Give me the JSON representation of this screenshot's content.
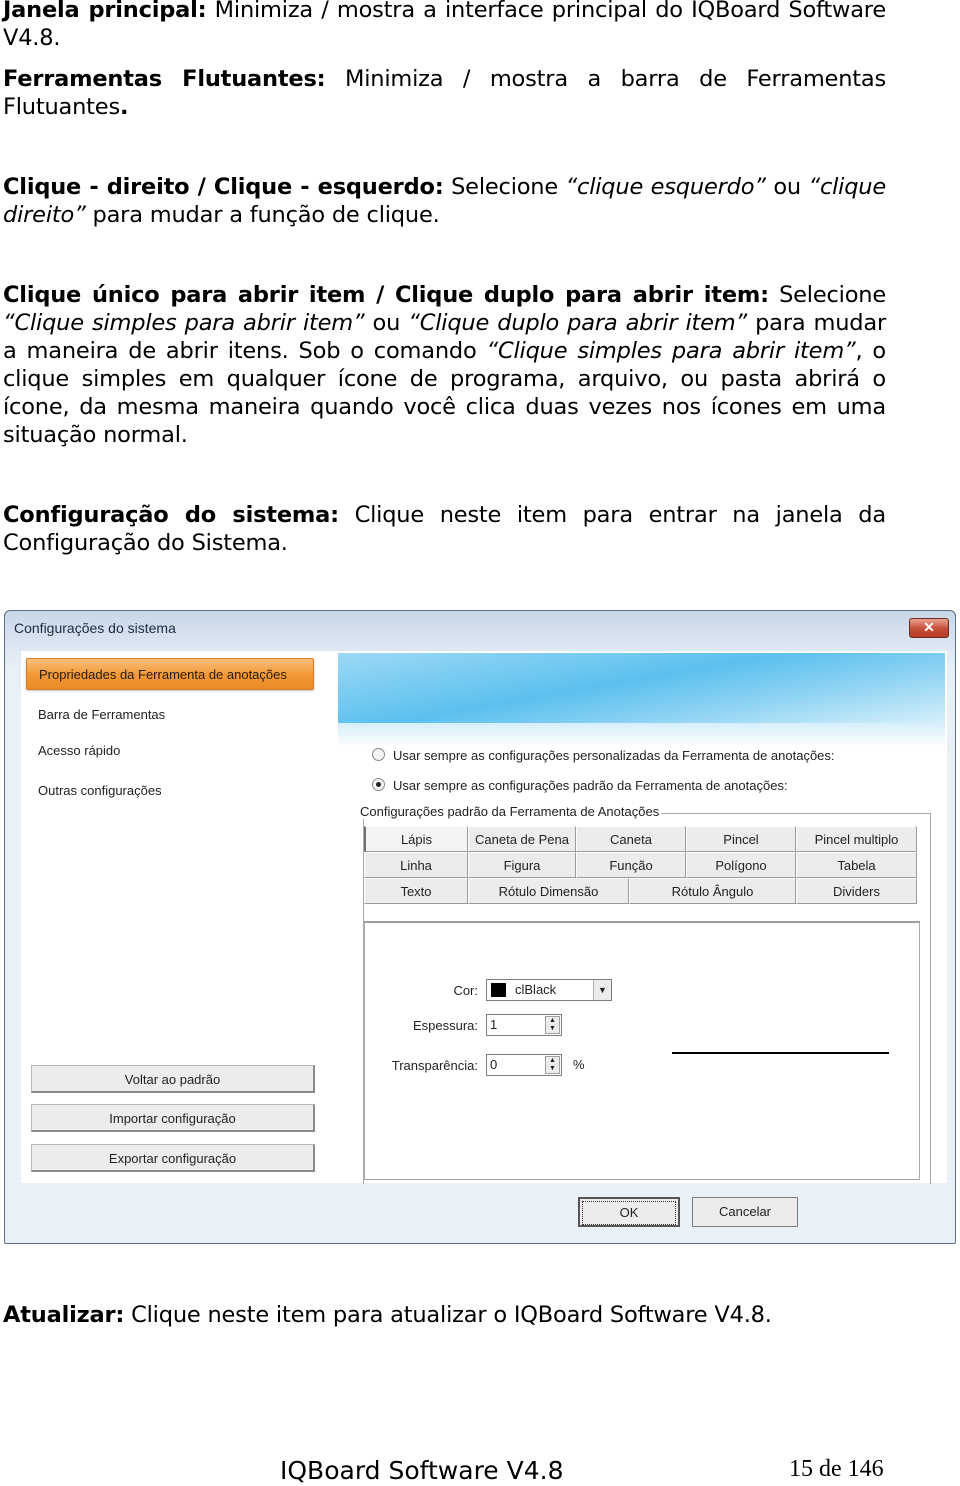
{
  "paragraphs": [
    {
      "term": "Janela principal:",
      "segments": [
        {
          "t": " Minimiza / mostra a interface principal do IQBoard Software V4.8.",
          "i": false
        }
      ]
    },
    {
      "term": "Ferramentas Flutuantes:",
      "segments": [
        {
          "t": " Minimiza / mostra a barra de Ferramentas Flutuantes",
          "i": false
        },
        {
          "t": ".",
          "b": true
        }
      ]
    },
    {
      "term": "Clique - direito / Clique - esquerdo:",
      "segments": [
        {
          "t": " Selecione ",
          "i": false
        },
        {
          "t": "“clique esquerdo”",
          "i": true
        },
        {
          "t": " ou ",
          "i": false
        },
        {
          "t": "“clique direito”",
          "i": true
        },
        {
          "t": " para mudar a função de clique.",
          "i": false
        }
      ]
    },
    {
      "term": "Clique único para abrir item / Clique duplo para abrir item:",
      "segments": [
        {
          "t": " Selecione ",
          "i": false
        },
        {
          "t": "“Clique simples para abrir item”",
          "i": true
        },
        {
          "t": " ou ",
          "i": false
        },
        {
          "t": "“Clique duplo para abrir item”",
          "i": true
        },
        {
          "t": " para mudar a maneira de abrir itens. Sob o comando ",
          "i": false
        },
        {
          "t": "“Clique simples para abrir item”",
          "i": true
        },
        {
          "t": ", o clique simples em qualquer ícone de programa, arquivo, ou pasta abrirá o ícone, da mesma maneira quando você clica duas vezes nos ícones em uma situação normal.",
          "i": false
        }
      ]
    },
    {
      "term": "Configuração do sistema:",
      "segments": [
        {
          "t": " Clique neste item para entrar na janela da Configuração do Sistema.",
          "i": false
        }
      ]
    },
    {
      "term": "Atualizar:",
      "segments": [
        {
          "t": " Clique neste item para atualizar o IQBoard Software V4.8.",
          "i": false
        }
      ]
    }
  ],
  "dialog": {
    "title": "Configurações do sistema",
    "close_icon": "close-x",
    "sidebar": {
      "items": [
        {
          "label": "Propriedades da Ferramenta de anotações",
          "active": true
        },
        {
          "label": "Barra de Ferramentas",
          "active": false
        },
        {
          "label": "Acesso rápido",
          "active": false
        },
        {
          "label": "Outras configurações",
          "active": false
        }
      ],
      "buttons": [
        "Voltar ao padrão",
        "Importar configuração",
        "Exportar configuração"
      ]
    },
    "radios": [
      {
        "label": "Usar sempre as configurações personalizadas da Ferramenta de anotações:",
        "checked": false
      },
      {
        "label": "Usar sempre as configurações padrão da Ferramenta de anotações:",
        "checked": true
      }
    ],
    "group_label": "Configurações padrão da Ferramenta de Anotações",
    "tab_rows": [
      [
        "Lápis",
        "Caneta de Pena",
        "Caneta",
        "Pincel",
        "Pincel multiplo"
      ],
      [
        "Linha",
        "Figura",
        "Função",
        "Polígono",
        "Tabela"
      ],
      [
        "Texto",
        "Rótulo Dimensão",
        "Rótulo Ângulo",
        "Dividers"
      ]
    ],
    "active_tab": "Lápis",
    "fields": {
      "color_label": "Cor:",
      "color_value": "clBlack",
      "color_swatch": "#000000",
      "thickness_label": "Espessura:",
      "thickness_value": "1",
      "transparency_label": "Transparência:",
      "transparency_value": "0",
      "transparency_unit": "%"
    },
    "ok_label": "OK",
    "cancel_label": "Cancelar"
  },
  "footer": {
    "title": "IQBoard Software V4.8",
    "page": "15 de 146"
  }
}
